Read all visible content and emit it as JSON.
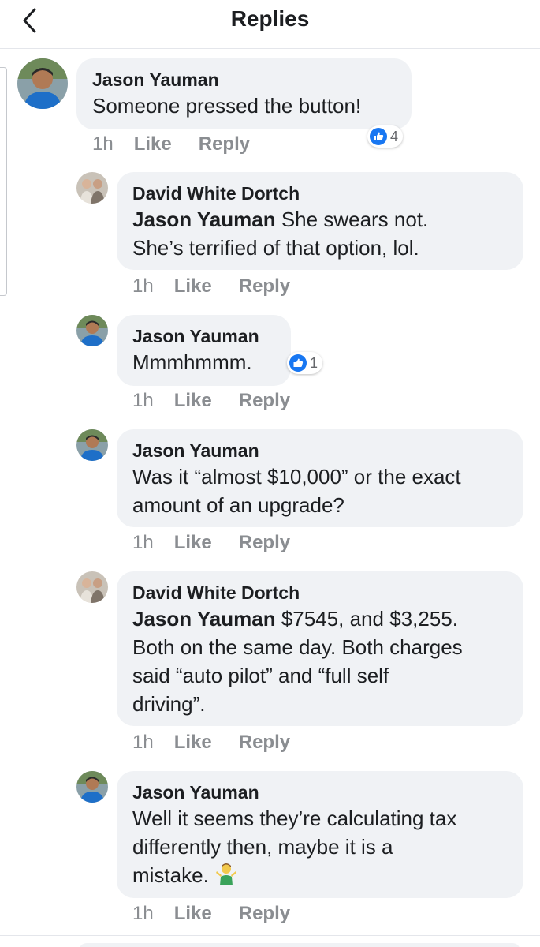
{
  "header": {
    "title": "Replies",
    "back_icon": "chevron-left-icon"
  },
  "colors": {
    "bubble": "#f0f2f5",
    "meta": "#8a8d91",
    "like_blue": "#1877f2"
  },
  "comments": [
    {
      "author": "Jason Yauman",
      "mention": "",
      "text": "Someone pressed the button!",
      "time": "1h",
      "like": "Like",
      "reply": "Reply",
      "reaction_count": "4"
    },
    {
      "author": "David White Dortch",
      "mention": "Jason Yauman",
      "line1": "She swears not.",
      "line2": "She’s terrified of that option, lol.",
      "time": "1h",
      "like": "Like",
      "reply": "Reply"
    },
    {
      "author": "Jason Yauman",
      "text": "Mmmhmmm.",
      "time": "1h",
      "like": "Like",
      "reply": "Reply",
      "reaction_count": "1"
    },
    {
      "author": "Jason Yauman",
      "line1": "Was it “almost $10,000” or the exact",
      "line2": "amount of an upgrade?",
      "time": "1h",
      "like": "Like",
      "reply": "Reply"
    },
    {
      "author": "David White Dortch",
      "mention": "Jason Yauman",
      "line1": "$7545, and $3,255.",
      "line2": "Both on the same day. Both charges",
      "line3": "said “auto pilot” and “full self",
      "line4": "driving”.",
      "time": "1h",
      "like": "Like",
      "reply": "Reply"
    },
    {
      "author": "Jason Yauman",
      "line1": "Well it seems they’re calculating tax",
      "line2": "differently then, maybe it is a",
      "line3": "mistake.",
      "emoji": "person-shrugging-emoji",
      "time": "1h",
      "like": "Like",
      "reply": "Reply"
    }
  ]
}
